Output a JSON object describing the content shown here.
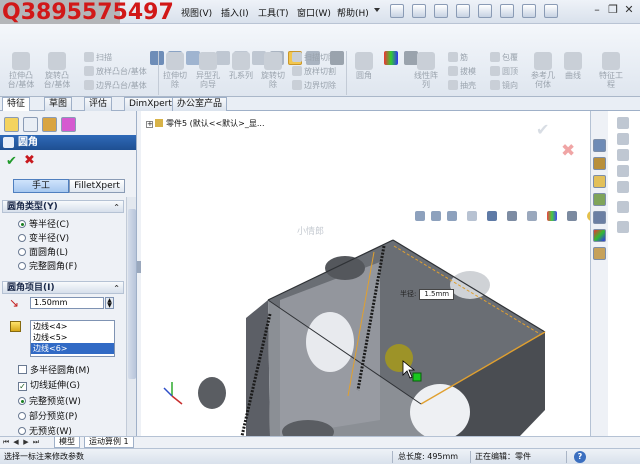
{
  "watermark": "Q3895575497",
  "menu": {
    "items": [
      "视图(V)",
      "插入(I)",
      "工具(T)",
      "窗口(W)",
      "帮助(H)"
    ]
  },
  "command_manager": {
    "big_tools": [
      {
        "label1": "拉伸凸",
        "label2": "台/基体",
        "color": "#c9cfd7"
      },
      {
        "label1": "旋转凸",
        "label2": "台/基体",
        "color": "#c9cfd7"
      },
      {
        "label1": "拉伸切",
        "label2": "除",
        "color": "#c9cfd7"
      },
      {
        "label1": "异型孔",
        "label2": "向导",
        "color": "#c9cfd7"
      },
      {
        "label1": "孔系列",
        "label2": "",
        "color": "#c9cfd7"
      },
      {
        "label1": "旋转切",
        "label2": "除",
        "color": "#c9cfd7"
      },
      {
        "label1": "圆角",
        "label2": "",
        "color": "#c9cfd7"
      },
      {
        "label1": "线性阵",
        "label2": "列",
        "color": "#c9cfd7"
      },
      {
        "label1": "参考几",
        "label2": "何体",
        "color": "#c9cfd7"
      },
      {
        "label1": "曲线",
        "label2": "",
        "color": "#c9cfd7"
      },
      {
        "label1": "特征工",
        "label2": "程",
        "color": "#c9cfd7"
      }
    ],
    "small_tools": [
      "扫描",
      "放样凸台/基体",
      "边界凸台/基体",
      "扫描切除",
      "放样切割",
      "边界切除",
      "筋",
      "拔模",
      "抽壳",
      "包覆",
      "圆顶",
      "镜向"
    ]
  },
  "tabs": [
    "特征",
    "草图",
    "评估",
    "DimXpert",
    "办公室产品"
  ],
  "property_manager": {
    "title": "圆角",
    "modes": [
      "手工",
      "FilletXpert"
    ],
    "fillet_type": {
      "header": "圆角类型(Y)",
      "options": [
        "等半径(C)",
        "变半径(V)",
        "面圆角(L)",
        "完整圆角(F)"
      ],
      "selected": 0
    },
    "fillet_items": {
      "header": "圆角项目(I)",
      "radius": "1.50mm",
      "edges": [
        "边线<4>",
        "边线<5>",
        "边线<6>"
      ],
      "selected_edge": 2,
      "multi_radius": "多半径圆角(M)",
      "tangent_propagation": "切线延伸(G)",
      "preview_options": [
        "完整预览(W)",
        "部分预览(P)",
        "无预览(W)"
      ],
      "preview_selected": 0
    }
  },
  "graphics": {
    "tree_item": "零件5  (默认<<默认>_显...",
    "radius_callout_label": "半径:",
    "radius_callout_value": "1.5mm",
    "faint_label": "小情郎"
  },
  "bottom_tabs": [
    "模型",
    "运动算例 1"
  ],
  "status": {
    "message": "选择一标注来修改参数",
    "length": "总长度: 495mm",
    "editing": "正在编辑：零件",
    "help": "?"
  },
  "colors": {
    "watermark": "#d11818",
    "accent": "#2f6ab8",
    "fillet_edge": "#e0a030"
  }
}
